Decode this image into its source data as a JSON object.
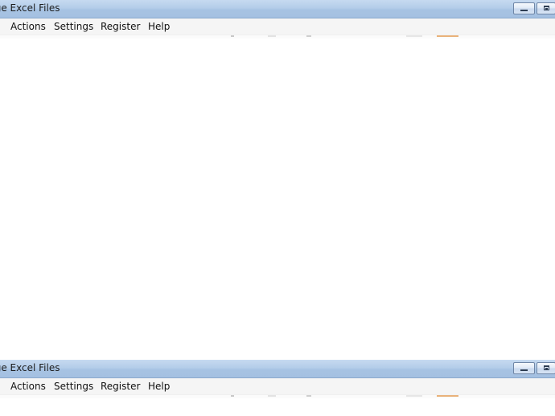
{
  "windows": {
    "top": {
      "title": "rge Excel Files",
      "menu": [
        "Actions",
        "Settings",
        "Register",
        "Help"
      ]
    },
    "bottom": {
      "title": "rge Excel Files",
      "menu": [
        "Actions",
        "Settings",
        "Register",
        "Help"
      ]
    }
  },
  "icons": {
    "minimize": "minimize-icon",
    "maximize": "maximize-icon"
  },
  "colors": {
    "titlebar": "#b4cde9",
    "menubar": "#f5f5f5",
    "content": "#ffffff",
    "toolbar_accent": "#e9b27a"
  }
}
